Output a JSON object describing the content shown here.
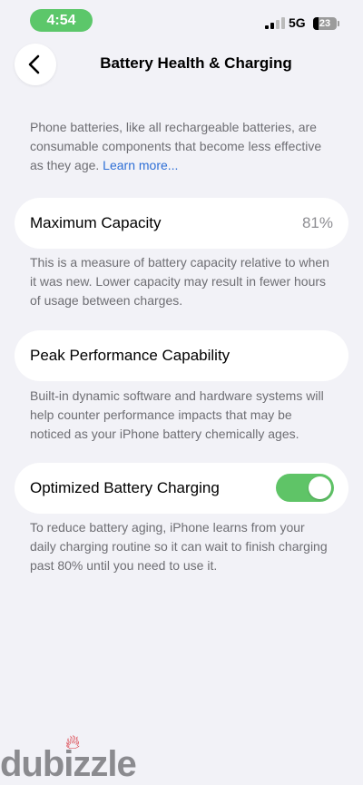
{
  "status": {
    "time": "4:54",
    "network": "5G",
    "battery_level": "23"
  },
  "nav": {
    "title": "Battery Health & Charging"
  },
  "intro": {
    "text": "Phone batteries, like all rechargeable batteries, are consumable components that become less effective as they age. ",
    "link": "Learn more..."
  },
  "max_capacity": {
    "label": "Maximum Capacity",
    "value": "81%",
    "description": "This is a measure of battery capacity relative to when it was new. Lower capacity may result in fewer hours of usage between charges."
  },
  "peak_performance": {
    "label": "Peak Performance Capability",
    "description": "Built-in dynamic software and hardware systems will help counter performance impacts that may be noticed as your iPhone battery chemically ages."
  },
  "optimized_charging": {
    "label": "Optimized Battery Charging",
    "enabled": true,
    "description": "To reduce battery aging, iPhone learns from your daily charging routine so it can wait to finish charging past 80% until you need to use it."
  },
  "watermark": {
    "text": "dubizzle"
  },
  "colors": {
    "accent_green": "#5fc467",
    "link_blue": "#2e6fd6",
    "background": "#f2f2f7"
  }
}
